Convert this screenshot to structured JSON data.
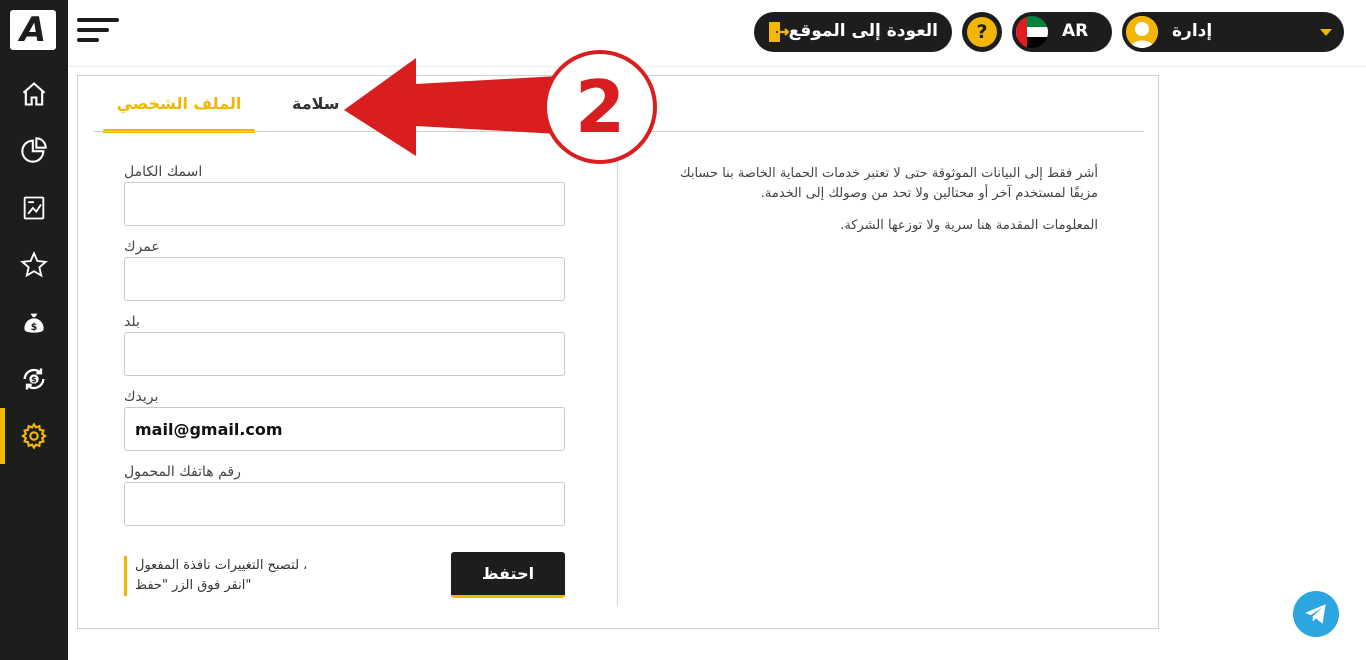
{
  "sidebar": {
    "logo": "A",
    "items": [
      {
        "icon": "home-icon"
      },
      {
        "icon": "pie-chart-icon"
      },
      {
        "icon": "report-icon"
      },
      {
        "icon": "star-icon"
      },
      {
        "icon": "money-bag-icon"
      },
      {
        "icon": "exchange-icon"
      },
      {
        "icon": "gear-icon",
        "active": true
      }
    ]
  },
  "header": {
    "back_label": "العودة إلى الموقع",
    "help_label": "?",
    "language": "AR",
    "user_name": "إدارة"
  },
  "tabs": [
    {
      "label": "الملف الشخصي",
      "active": true
    },
    {
      "label": "سلامة",
      "active": false
    }
  ],
  "form": {
    "fields": [
      {
        "label": "اسمك الكامل",
        "value": ""
      },
      {
        "label": "عمرك",
        "value": ""
      },
      {
        "label": "بلد",
        "value": ""
      },
      {
        "label": "بريدك",
        "value": "mail@gmail.com"
      },
      {
        "label": "رقم هاتفك المحمول",
        "value": ""
      }
    ],
    "note_line1": "لتصبح التغييرات نافذة المفعول ،",
    "note_line2": "انقر فوق الزر \"حفظ\"",
    "save_label": "احتفظ"
  },
  "info": {
    "paragraph1": "أشر فقط إلى البيانات الموثوقة حتى لا تعتبر خدمات الحماية الخاصة بنا حسابك مزيفًا لمستخدم آخر أو محتالين ولا تحد من وصولك إلى الخدمة.",
    "paragraph2": "المعلومات المقدمة هنا سرية ولا توزعها الشركة."
  },
  "annotation": {
    "number": "2"
  },
  "colors": {
    "accent": "#f2b705",
    "dark": "#1d1d1d",
    "annotation_red": "#d81e1e"
  }
}
